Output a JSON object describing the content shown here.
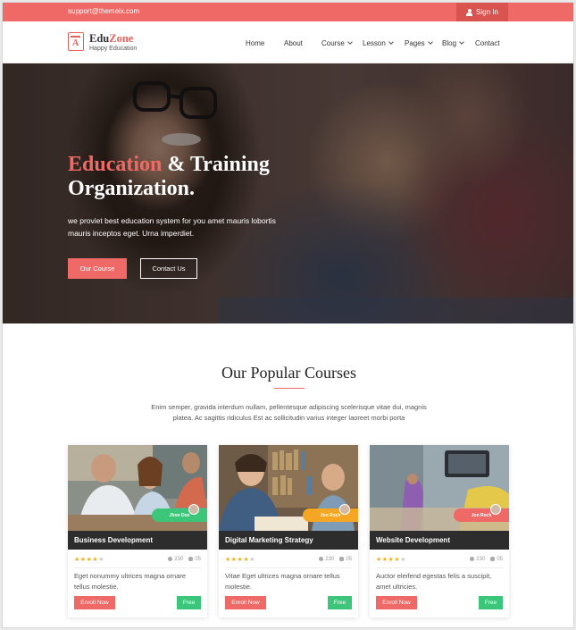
{
  "topbar": {
    "email": "support@themeix.com",
    "signin_label": "Sign In",
    "colors": {
      "bar": "#ef6a66",
      "signin_bg": "#d9544f"
    }
  },
  "header": {
    "logo": {
      "name_a": "Edu",
      "name_b": "Zone",
      "tagline": "Happy Education",
      "icon_letter": "A"
    },
    "nav": [
      {
        "label": "Home",
        "dropdown": false
      },
      {
        "label": "About",
        "dropdown": false
      },
      {
        "label": "Course",
        "dropdown": true
      },
      {
        "label": "Lesson",
        "dropdown": true
      },
      {
        "label": "Pages",
        "dropdown": true
      },
      {
        "label": "Blog",
        "dropdown": true
      },
      {
        "label": "Contact",
        "dropdown": false
      }
    ]
  },
  "hero": {
    "title_accent": "Education",
    "title_rest": " & Training Organization.",
    "text": "we proviet best education system for you amet mauris lobortis mauris inceptos eget. Urna imperdiet.",
    "primary_button": "Our Course",
    "secondary_button": "Contact Us"
  },
  "courses": {
    "title": "Our Popular Courses",
    "description": "Enim semper, gravida interdum nullam, pellentesque adipiscing scelerisque vitae dui, magnis platea. Ac sagittis ridiculus Est ac sollicitudin varius integer laoreet morbi porta",
    "items": [
      {
        "title": "Business Development",
        "author": "Jhon Doe",
        "author_color": "#3cc67a",
        "rating": 4,
        "students": "230",
        "comments": "05",
        "desc": "Eget nonummy ultrices magna ornare tellus molestie.",
        "enroll_label": "Enroll Now",
        "price_label": "Free",
        "image": "business-team-photo"
      },
      {
        "title": "Digital Marketing Strategy",
        "author": "Jon Rock",
        "author_color": "#f5a623",
        "rating": 4,
        "students": "230",
        "comments": "05",
        "desc": "Vitae Eget ultrices magna ornare tellus molestie.",
        "enroll_label": "Enroll Now",
        "price_label": "Free",
        "image": "library-students-photo"
      },
      {
        "title": "Website Development",
        "author": "Jon Rock",
        "author_color": "#ef6a66",
        "rating": 4,
        "students": "230",
        "comments": "05",
        "desc": "Auctor eleifend egestas felis a suscipit, amet ultricies.",
        "enroll_label": "Enroll Now",
        "price_label": "Free",
        "image": "tablet-desk-photo"
      }
    ]
  },
  "accent_color": "#ef6a66"
}
